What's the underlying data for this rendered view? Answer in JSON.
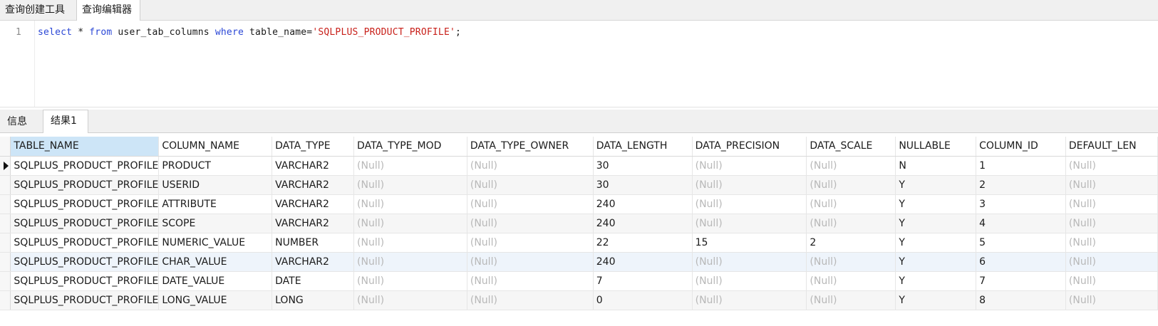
{
  "editor_tabs": [
    "查询创建工具",
    "查询编辑器"
  ],
  "editor": {
    "line_number": "1",
    "sql": {
      "kw_select": "select",
      "star": " * ",
      "kw_from": "from",
      "table": " user_tab_columns ",
      "kw_where": "where",
      "cond": " table_name=",
      "literal": "'SQLPLUS_PRODUCT_PROFILE'",
      "end": ";"
    }
  },
  "result_tabs": [
    "信息",
    "结果1"
  ],
  "grid": {
    "columns": [
      "TABLE_NAME",
      "COLUMN_NAME",
      "DATA_TYPE",
      "DATA_TYPE_MOD",
      "DATA_TYPE_OWNER",
      "DATA_LENGTH",
      "DATA_PRECISION",
      "DATA_SCALE",
      "NULLABLE",
      "COLUMN_ID",
      "DEFAULT_LEN"
    ],
    "rows": [
      [
        "SQLPLUS_PRODUCT_PROFILE",
        "PRODUCT",
        "VARCHAR2",
        "(Null)",
        "(Null)",
        "30",
        "(Null)",
        "(Null)",
        "N",
        "1",
        "(Null)"
      ],
      [
        "SQLPLUS_PRODUCT_PROFILE",
        "USERID",
        "VARCHAR2",
        "(Null)",
        "(Null)",
        "30",
        "(Null)",
        "(Null)",
        "Y",
        "2",
        "(Null)"
      ],
      [
        "SQLPLUS_PRODUCT_PROFILE",
        "ATTRIBUTE",
        "VARCHAR2",
        "(Null)",
        "(Null)",
        "240",
        "(Null)",
        "(Null)",
        "Y",
        "3",
        "(Null)"
      ],
      [
        "SQLPLUS_PRODUCT_PROFILE",
        "SCOPE",
        "VARCHAR2",
        "(Null)",
        "(Null)",
        "240",
        "(Null)",
        "(Null)",
        "Y",
        "4",
        "(Null)"
      ],
      [
        "SQLPLUS_PRODUCT_PROFILE",
        "NUMERIC_VALUE",
        "NUMBER",
        "(Null)",
        "(Null)",
        "22",
        "15",
        "2",
        "Y",
        "5",
        "(Null)"
      ],
      [
        "SQLPLUS_PRODUCT_PROFILE",
        "CHAR_VALUE",
        "VARCHAR2",
        "(Null)",
        "(Null)",
        "240",
        "(Null)",
        "(Null)",
        "Y",
        "6",
        "(Null)"
      ],
      [
        "SQLPLUS_PRODUCT_PROFILE",
        "DATE_VALUE",
        "DATE",
        "(Null)",
        "(Null)",
        "7",
        "(Null)",
        "(Null)",
        "Y",
        "7",
        "(Null)"
      ],
      [
        "SQLPLUS_PRODUCT_PROFILE",
        "LONG_VALUE",
        "LONG",
        "(Null)",
        "(Null)",
        "0",
        "(Null)",
        "(Null)",
        "Y",
        "8",
        "(Null)"
      ]
    ]
  }
}
